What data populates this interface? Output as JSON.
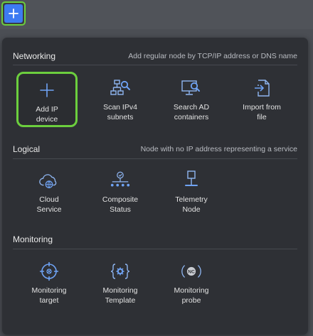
{
  "colors": {
    "accent": "#3d7bf2",
    "highlight": "#6ccf3e",
    "panel": "#2e3035"
  },
  "sections": [
    {
      "title": "Networking",
      "description": "Add regular node by TCP/IP address or DNS name",
      "items": [
        {
          "label": "Add IP\ndevice",
          "icon": "plus-icon",
          "selected": true
        },
        {
          "label": "Scan IPv4\nsubnets",
          "icon": "network-scan-icon"
        },
        {
          "label": "Search AD\ncontainers",
          "icon": "monitor-search-icon"
        },
        {
          "label": "Import from\nfile",
          "icon": "file-import-icon"
        }
      ]
    },
    {
      "title": "Logical",
      "description": "Node with no IP address representing a service",
      "items": [
        {
          "label": "Cloud\nService",
          "icon": "cloud-globe-icon"
        },
        {
          "label": "Composite\nStatus",
          "icon": "composite-tree-icon"
        },
        {
          "label": "Telemetry\nNode",
          "icon": "telemetry-node-icon"
        }
      ]
    },
    {
      "title": "Monitoring",
      "description": "",
      "items": [
        {
          "label": "Monitoring\ntarget",
          "icon": "target-crosshair-icon"
        },
        {
          "label": "Monitoring\nTemplate",
          "icon": "template-gear-icon"
        },
        {
          "label": "Monitoring\nprobe",
          "icon": "probe-nc-icon"
        }
      ]
    }
  ]
}
